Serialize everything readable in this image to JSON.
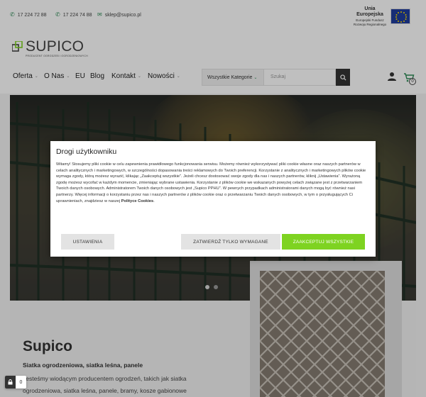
{
  "contact": {
    "phone1": "17 224 72 88",
    "phone2": "17 224 74 88",
    "email": "sklep@supico.pl",
    "phone_icon": "phone-icon",
    "email_icon": "envelope-icon"
  },
  "eu_badge": {
    "title": "Unia Europejska",
    "line1": "Europejski Fundusz",
    "line2": "Rozwoju Regionalnego"
  },
  "logo": {
    "name": "SUPICO",
    "tagline": "PRODUCENT OGRODZEŃ I OGRODZENIOWYCH"
  },
  "nav": {
    "items": [
      {
        "label": "Oferta",
        "has_dropdown": true
      },
      {
        "label": "O Nas",
        "has_dropdown": true
      },
      {
        "label": "EU",
        "has_dropdown": false
      },
      {
        "label": "Blog",
        "has_dropdown": false
      },
      {
        "label": "Kontakt",
        "has_dropdown": true
      },
      {
        "label": "Nowości",
        "has_dropdown": true
      }
    ],
    "category_select": "Wszystkie Kategorie",
    "search_placeholder": "Szukaj",
    "cart_count": "0"
  },
  "hero": {
    "slides": 2,
    "active_slide": 1
  },
  "section": {
    "title": "Supico",
    "subtitle": "Siatka ogrodzeniowa, siatka leśna, panele",
    "text": "Jesteśmy wiodącym producentem ogrodzeń, takich jak siatka ogrodzeniowa, siatka leśna, panele, bramy, kosze gabionowe"
  },
  "cookie_modal": {
    "title": "Drogi użytkowniku",
    "body": "Witamy! Stosujemy pliki cookie w celu zapewnienia prawidłowego funkcjonowania serwisu. Możemy również wykorzystywać pliki cookie własne oraz naszych partnerów w celach analitycznych i marketingowych, w szczególności dopasowania treści reklamowych do Twoich preferencji. Korzystanie z analitycznych i marketingowych plików cookie wymaga zgody, którą możesz wyrazić, klikając „Zaakceptuj wszystkie”. Jeżeli chcesz dostosować swoje zgody dla nas i naszych partnerów, kliknij „Ustawienia”. Wyrażoną zgodę możesz wycofać w każdym momencie, zmieniając wybrane ustawienia. Korzystanie z plików cookie we wskazanych powyżej celach związane jest z przetwarzaniem Twoich danych osobowych. Administratorem Twoich danych osobowych jest „Supico PPHU”. W pewnych przypadkach administratorami danych mogą być również nasi partnerzy. Więcej informacji o korzystaniu przez nas i naszych partnerów z plików cookie oraz o przetwarzaniu Twoich danych osobowych, w tym o przysługujących Ci uprawnieniach, znajdziesz w naszej",
    "policy_link": "Polityce Cookies",
    "policy_end": ".",
    "btn_settings": "USTAWIENIA",
    "btn_required": "ZATWIERDŹ TYLKO WYMAGANE",
    "btn_accept": "ZAAKCEPTUJ WSZYSTKIE"
  },
  "widget": {
    "count": "0",
    "icon": "lock-icon"
  },
  "colors": {
    "accent_green": "#7ed321",
    "brand_green": "#2e8b57",
    "dark": "#333333"
  }
}
